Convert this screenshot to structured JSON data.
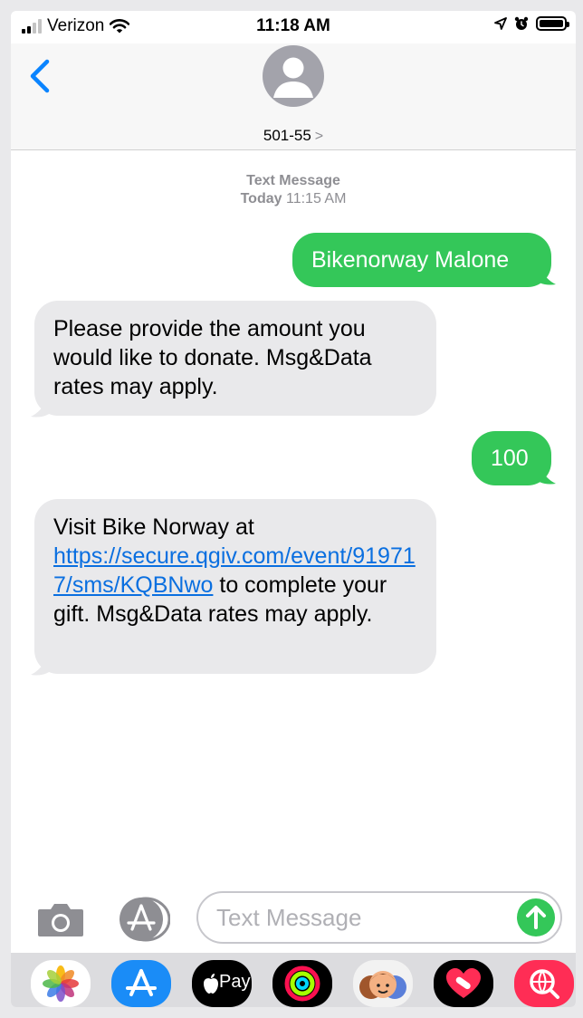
{
  "status_bar": {
    "carrier": "Verizon",
    "time": "11:18 AM",
    "icons": [
      "cellular-signal-icon",
      "wifi-icon",
      "location-arrow-icon",
      "alarm-icon",
      "battery-icon"
    ]
  },
  "header": {
    "contact": "501-55",
    "chevron": ">",
    "icons": [
      "back-chevron-icon",
      "contact-avatar-icon"
    ]
  },
  "thread": {
    "meta_type": "Text Message",
    "meta_day": "Today",
    "meta_time": "11:15 AM",
    "messages": [
      {
        "direction": "outgoing",
        "text": "Bikenorway Malone"
      },
      {
        "direction": "incoming",
        "text": "Please provide the amount you would like to donate. Msg&Data rates may apply."
      },
      {
        "direction": "outgoing",
        "text": "100"
      },
      {
        "direction": "incoming",
        "text_before": "Visit Bike Norway at ",
        "link": "https://secure.qgiv.com/event/919717/sms/KQBNwo",
        "text_after": " to complete your gift. Msg&Data rates may apply."
      }
    ]
  },
  "input_bar": {
    "placeholder": "Text Message",
    "icons": [
      "camera-icon",
      "app-store-icon",
      "send-arrow-icon"
    ]
  },
  "dock": {
    "apple_pay_label": "Pay",
    "apps": [
      "photos-icon",
      "app-store-icon",
      "apple-pay-icon",
      "activity-icon",
      "memoji-icon",
      "heart-sticker-icon",
      "search-globe-icon"
    ]
  },
  "colors": {
    "imessage_green": "#34c759",
    "incoming_gray": "#e9e9eb",
    "link_blue": "#0a6fe0",
    "ios_blue": "#0a84ff"
  }
}
